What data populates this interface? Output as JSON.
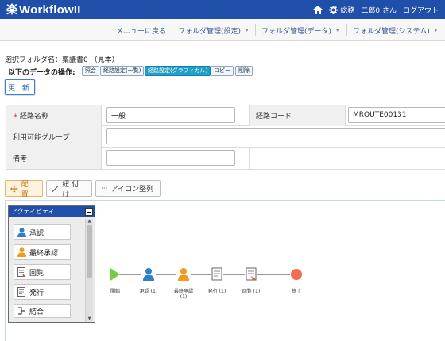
{
  "header": {
    "logo_mark": "楽",
    "logo_text": "WorkflowII",
    "nav": {
      "general": "総務",
      "user": "二郎0 さん",
      "logout": "ログアウト"
    }
  },
  "menubar": {
    "items": [
      {
        "label": "メニューに戻る"
      },
      {
        "label": "フォルダ管理(設定)"
      },
      {
        "label": "フォルダ管理(データ)"
      },
      {
        "label": "フォルダ管理(システム)"
      }
    ]
  },
  "folder": {
    "selected": "選択フォルダ名：稟議書0 （見本）"
  },
  "operations": {
    "label": "以下のデータの操作:",
    "buttons": [
      "照会",
      "経路設定(一覧)",
      "経路設定(グラフィカル)",
      "コピー",
      "削除"
    ],
    "update": "更 新"
  },
  "form": {
    "route_name_label": "経路名称",
    "route_name_value": "一般",
    "route_code_label": "経路コード",
    "route_code_value": "MROUTE00131",
    "group_label": "利用可能グループ",
    "group_value": "",
    "remarks_label": "備考",
    "remarks_value": ""
  },
  "tools": {
    "place": "配 置",
    "link": "紐 付 け",
    "align": "アイコン整列"
  },
  "palette": {
    "title": "アクティビティ",
    "items": [
      "承認",
      "最終承認",
      "回覧",
      "発行",
      "結合"
    ]
  },
  "flow": {
    "nodes": [
      {
        "label": "開始",
        "type": "start"
      },
      {
        "label": "承認 (1)",
        "type": "approve"
      },
      {
        "label": "最終承認",
        "sub": "(1)",
        "type": "final"
      },
      {
        "label": "発行 (1)",
        "type": "issue"
      },
      {
        "label": "回覧 (1)",
        "type": "circulate"
      },
      {
        "label": "終了",
        "type": "end"
      }
    ]
  },
  "colors": {
    "header": "#1f4fa8",
    "active_op": "#1fa0c8",
    "start": "#7ac943",
    "end": "#f26c4f",
    "person_blue": "#2f7fc7",
    "person_orange": "#f39a1e"
  }
}
